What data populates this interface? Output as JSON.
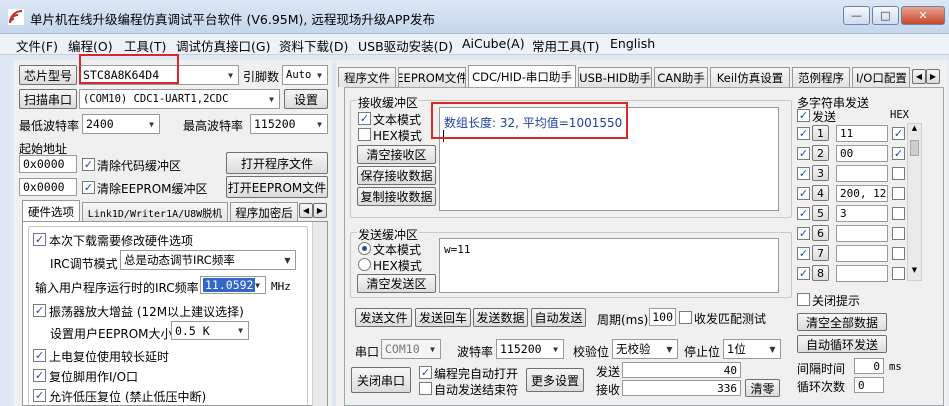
{
  "window": {
    "title": "单片机在线升级编程仿真调试平台软件 (V6.95M), 远程现场升级APP发布",
    "min": "—",
    "max": "□",
    "close": "✕"
  },
  "menu": [
    "文件(F)",
    "编程(O)",
    "工具(T)",
    "调试仿真接口(G)",
    "资料下载(D)",
    "USB驱动安装(D)",
    "AiCube(A)",
    "常用工具(T)",
    "English"
  ],
  "left": {
    "chip_label": "芯片型号",
    "chip_value": "STC8A8K64D4",
    "pin_label": "引脚数",
    "pin_value": "Auto",
    "scan_label": "扫描串口",
    "port_value": "(COM10) CDC1-UART1,2CDC",
    "settings_label": "设置",
    "min_baud_label": "最低波特率",
    "min_baud_value": "2400",
    "max_baud_label": "最高波特率",
    "max_baud_value": "115200",
    "start_addr_label": "起始地址",
    "addr1_value": "0x0000",
    "clear_code_label": "清除代码缓冲区",
    "open_prog_label": "打开程序文件",
    "addr2_value": "0x0000",
    "clear_eeprom_label": "清除EEPROM缓冲区",
    "open_eeprom_label": "打开EEPROM文件",
    "tabs": [
      "硬件选项",
      "Link1D/Writer1A/U8W脱机",
      "程序加密后"
    ],
    "opt_modify_label": "本次下载需要修改硬件选项",
    "irc_mode_label": "IRC调节模式",
    "irc_mode_value": "总是动态调节IRC频率",
    "irc_freq_label": "输入用户程序运行时的IRC频率",
    "irc_freq_value": "11.0592",
    "mhz_label": "MHz",
    "osc_gain_label": "振荡器放大增益 (12M以上建议选择)",
    "eeprom_size_label": "设置用户EEPROM大小",
    "eeprom_size_value": "0.5 K",
    "power_reset_label": "上电复位使用较长延时",
    "reset_io_label": "复位脚用作I/O口",
    "lowv_reset_label": "允许低压复位 (禁止低压中断)"
  },
  "right": {
    "tabs": [
      "程序文件",
      "EEPROM文件",
      "CDC/HID-串口助手",
      "USB-HID助手",
      "CAN助手",
      "Keil仿真设置",
      "范例程序",
      "I/O口配置"
    ],
    "recv_group": "接收缓冲区",
    "recv_text_mode": "文本模式",
    "recv_hex_mode": "HEX模式",
    "clear_recv": "清空接收区",
    "save_recv": "保存接收数据",
    "copy_recv": "复制接收数据",
    "recv_content": "数组长度: 32,   平均值=1001550",
    "send_group": "发送缓冲区",
    "send_text_mode": "文本模式",
    "send_hex_mode": "HEX模式",
    "clear_send": "清空发送区",
    "send_content": "w=11",
    "send_file": "发送文件",
    "send_return": "发送回车",
    "send_data": "发送数据",
    "auto_send": "自动发送",
    "period_label": "周期(ms)",
    "period_value": "100",
    "match_label": "收发匹配测试",
    "port_label": "串口",
    "port_value": "COM10",
    "baud_label": "波特率",
    "baud_value": "115200",
    "parity_label": "校验位",
    "parity_value": "无校验",
    "stop_label": "停止位",
    "stop_value": "1位",
    "close_port": "关闭串口",
    "auto_open_label": "编程完自动打开",
    "auto_end_label": "自动发送结束符",
    "more_settings": "更多设置",
    "sent_label": "发送",
    "sent_value": "40",
    "recv_label": "接收",
    "recv_value": "336",
    "clear_count": "清零",
    "multi_title": "多字符串发送",
    "multi_send_col": "发送",
    "multi_hex_col": "HEX",
    "multi_rows": [
      {
        "n": "1",
        "v": "11"
      },
      {
        "n": "2",
        "v": "00"
      },
      {
        "n": "3",
        "v": ""
      },
      {
        "n": "4",
        "v": "200, 120,"
      },
      {
        "n": "5",
        "v": "3"
      },
      {
        "n": "6",
        "v": ""
      },
      {
        "n": "7",
        "v": ""
      },
      {
        "n": "8",
        "v": ""
      }
    ],
    "close_hint": "关闭提示",
    "clear_all": "清空全部数据",
    "auto_loop": "自动循环发送",
    "interval_label": "间隔时间",
    "interval_value": "0",
    "ms_label": "ms",
    "loop_count_label": "循环次数",
    "loop_count_value": "0"
  },
  "colors": {
    "accent": "#1f4fa8",
    "highlight": "#d9282b",
    "recv_text": "#1f3fa0"
  }
}
